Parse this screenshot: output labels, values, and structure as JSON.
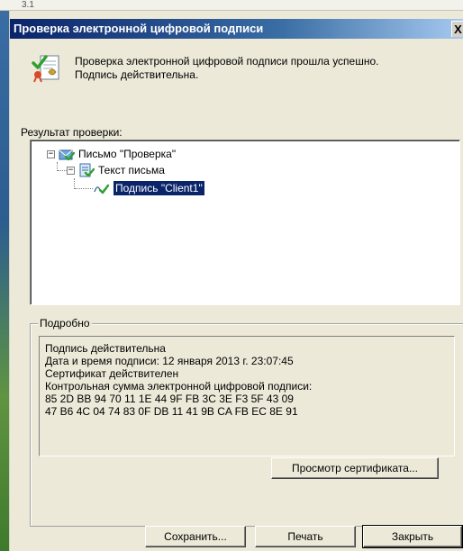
{
  "window": {
    "title": "Проверка электронной цифровой подписи",
    "close_glyph": "X"
  },
  "desktop": {
    "top_text": "3.1"
  },
  "header": {
    "line1": "Проверка электронной цифровой подписи прошла успешно.",
    "line2": "Подпись действительна."
  },
  "result": {
    "label": "Результат проверки:",
    "tree": [
      {
        "label": "Письмо \"Проверка\"",
        "icon": "envelope-check-icon",
        "expander": "−"
      },
      {
        "label": "Текст письма",
        "icon": "document-check-icon",
        "expander": "−"
      },
      {
        "label": "Подпись \"Client1\"",
        "icon": "signature-check-icon",
        "selected": true
      }
    ]
  },
  "details": {
    "legend": "Подробно",
    "lines": [
      "Подпись действительна",
      "Дата и время подписи: 12 января 2013 г. 23:07:45",
      "Сертификат действителен",
      "Контрольная сумма электронной цифровой подписи:",
      "85 2D BB 94 70 11 1E 44 9F FB 3C 3E F3 5F 43 09",
      "47 B6 4C 04 74 83 0F DB 11 41 9B CA FB EC 8E 91"
    ]
  },
  "buttons": {
    "view_certificate": "Просмотр сертификата...",
    "save": "Сохранить...",
    "print": "Печать",
    "close": "Закрыть"
  },
  "colors": {
    "selection": "#0a246a",
    "titlebar": "#0a246a",
    "face": "#ece9d8",
    "check": "#2fa12f"
  }
}
